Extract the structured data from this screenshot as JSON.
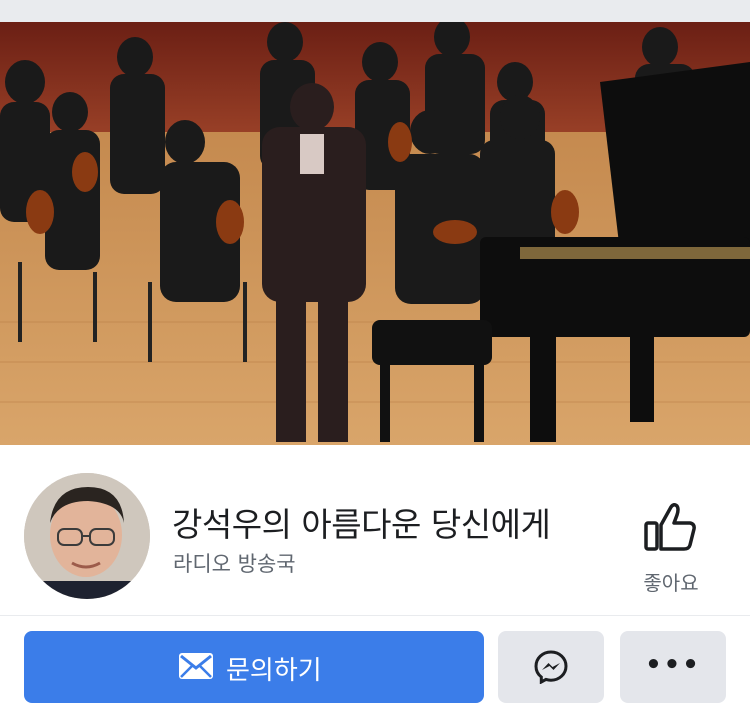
{
  "page": {
    "name": "강석우의 아름다운 당신에게",
    "category": "라디오 방송국"
  },
  "like": {
    "label": "좋아요",
    "icon": "thumbs-up-icon"
  },
  "actions": {
    "contact_label": "문의하기",
    "contact_icon": "envelope-icon",
    "messenger_icon": "messenger-icon",
    "more_label": "•••",
    "more_icon": "more-icon"
  },
  "colors": {
    "primary_button": "#3b7de9",
    "secondary_button": "#e4e6eb",
    "title_text": "#1c1e21",
    "subtitle_text": "#606770"
  }
}
